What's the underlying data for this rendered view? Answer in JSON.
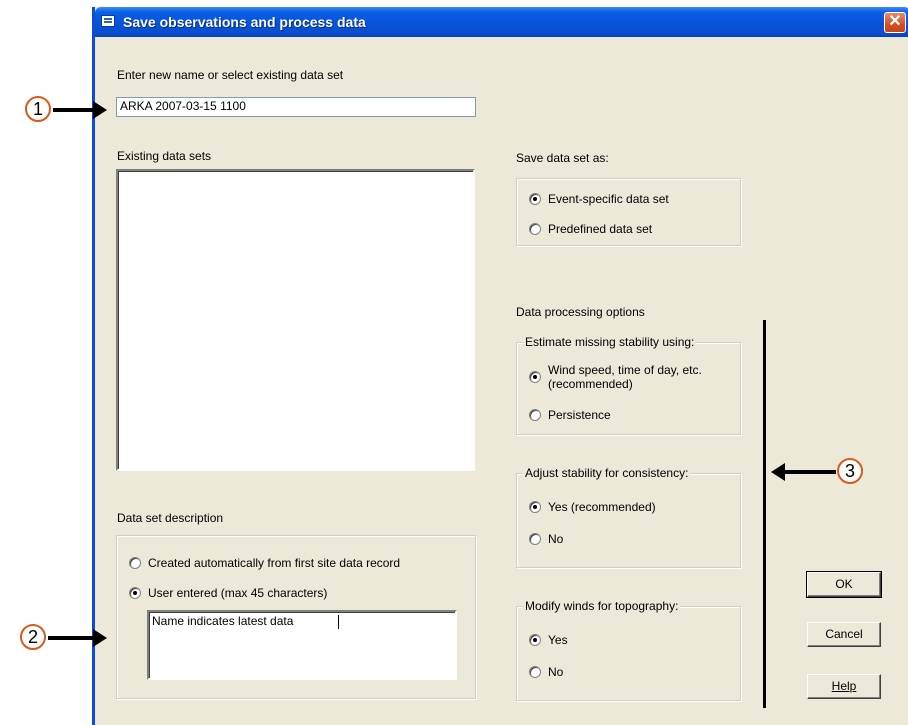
{
  "window": {
    "title": "Save observations and process data",
    "close_glyph": "✕"
  },
  "name_section": {
    "label": "Enter new name or select existing data set",
    "value": "ARKA 2007-03-15 1100"
  },
  "existing": {
    "label": "Existing data sets",
    "items": []
  },
  "save_as": {
    "label": "Save data set as:",
    "options": [
      {
        "label": "Event-specific data set",
        "selected": true
      },
      {
        "label": "Predefined data set",
        "selected": false
      }
    ]
  },
  "processing": {
    "label": "Data processing options",
    "stability": {
      "title": "Estimate missing stability using:",
      "option1_line1": "Wind speed, time of day, etc.",
      "option1_line2": "(recommended)",
      "option2": "Persistence"
    },
    "adjust": {
      "title": "Adjust stability for consistency:",
      "yes": "Yes (recommended)",
      "no": "No"
    },
    "winds": {
      "title": "Modify winds for topography:",
      "yes": "Yes",
      "no": "No"
    }
  },
  "description": {
    "label": "Data set description",
    "option_auto": "Created automatically from first site data record",
    "option_user": "User entered (max 45 characters)",
    "text": "Name indicates latest data"
  },
  "buttons": {
    "ok": "OK",
    "cancel": "Cancel",
    "help": "Help"
  },
  "callouts": {
    "one": "1",
    "two": "2",
    "three": "3"
  },
  "colors": {
    "titlebar": "#0653d9",
    "dialog_bg": "#ece9d8",
    "callout_border": "#d95a1c"
  }
}
